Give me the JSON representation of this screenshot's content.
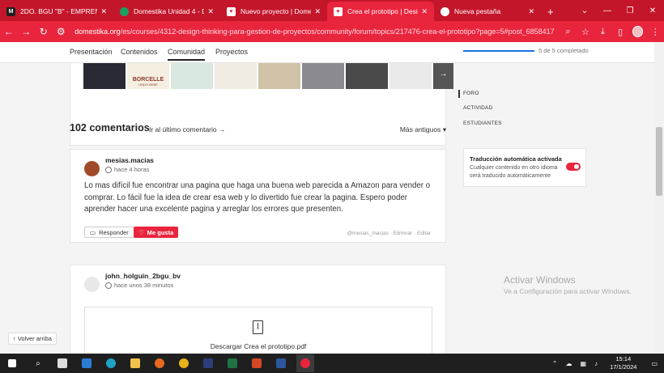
{
  "browser": {
    "tabs": [
      {
        "title": "2DO. BGU \"B\" - EMPRENDIM",
        "favicon": "M",
        "favicon_color": "#1f1f1f",
        "active": false
      },
      {
        "title": "Domestika Unidad 4 - Danie",
        "favicon": "",
        "favicon_color": "#1aa260",
        "active": false
      },
      {
        "title": "Nuevo proyecto | Domestika",
        "favicon": "",
        "favicon_color": "#e9253e",
        "active": false
      },
      {
        "title": "Crea el prototipo | Design Th",
        "favicon": "",
        "favicon_color": "#e9253e",
        "active": true
      },
      {
        "title": "Nueva pestaña",
        "favicon": "",
        "favicon_color": "#4285f4",
        "active": false
      }
    ],
    "new_tab": "+",
    "url_domain": "domestika.org",
    "url_path": "/es/courses/4312-design-thinking-para-gestion-de-proyectos/community/forum/topics/217476-crea-el-prototipo?page=5#post_6858417"
  },
  "subnav": {
    "items": [
      "Presentación",
      "Contenidos",
      "Comunidad",
      "Proyectos"
    ],
    "active": "Comunidad",
    "progress_text": "5 de 5 completado",
    "progress_fraction": 1.0
  },
  "thumbnails": {
    "colors": [
      "#2a2a35",
      "#8a3a2a",
      "#d9c9a8",
      "#e8e4dc",
      "#cfc2a6",
      "#6a6a70",
      "#4a4a4a",
      "#f0f0f0"
    ],
    "logo_text": "BORCELLE",
    "logo_sub": "UNDO BEBE",
    "arrow": "→"
  },
  "sidebar": {
    "links": [
      "FORO",
      "ACTIVIDAD",
      "ESTUDIANTES"
    ],
    "translation_title": "Traducción automática activada",
    "translation_desc": "Cualquier contenido en otro idioma será traducido automáticamente",
    "translation_on": true
  },
  "comments_header": {
    "count": "102 comentarios",
    "goto_last": "Ir al último comentario →",
    "sort": "Más antiguos ▾"
  },
  "comments": [
    {
      "user": "mesias.macias",
      "time": "hace 4 horas",
      "body": "Lo mas difícil fue encontrar una pagina que haga una buena web parecida a Amazon para vender o comprar. Lo fácil fue la idea de crear esa web y lo divertido fue crear la pagina. Espero poder aprender hacer una excelente pagina y arreglar los errores que presenten.",
      "reply": "Responder",
      "like": "Me gusta",
      "handle": "@mesias_macias",
      "delete": "Eliminar",
      "edit": "Editar"
    },
    {
      "user": "john_holguin_2bgu_bv",
      "time": "hace unos 38 minutos",
      "file": "Descargar Crea el prototipo.pdf"
    }
  ],
  "back_to_top": "↑ Volver arriba",
  "watermark": {
    "line1": "Activar Windows",
    "line2": "Ve a Configuración para activar Windows."
  },
  "taskbar": {
    "time": "15:14",
    "date": "17/1/2024"
  }
}
